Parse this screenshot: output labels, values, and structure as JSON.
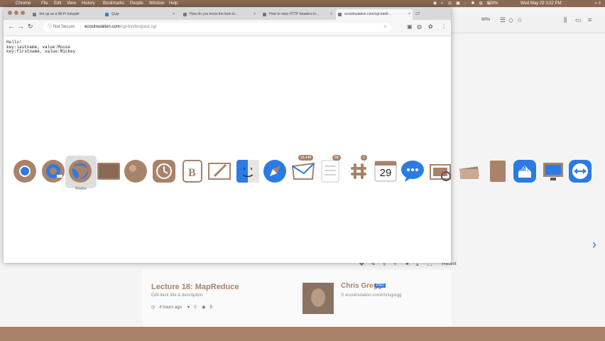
{
  "menubar": {
    "items": [
      "Chrome",
      "File",
      "Edit",
      "View",
      "History",
      "Bookmarks",
      "People",
      "Window",
      "Help"
    ],
    "battery": "100%",
    "clock": "Wed May 29 3:52 PM"
  },
  "chrome": {
    "tabs": [
      {
        "title": "Set up as a Wi-Fi hotspot"
      },
      {
        "title": "Quip"
      },
      {
        "title": "How do you know the item is..."
      },
      {
        "title": "How to view HTTP headers in..."
      },
      {
        "title": "ecosimulation.com/cgi-bin/tr..."
      }
    ],
    "address": {
      "security": "Not Secure",
      "domain": "ecosimulation.com",
      "path": "/cgi-bin/testpost.cgi"
    },
    "content_lines": [
      "Hello!",
      "key:lastname, value:Mouse",
      "key:firstname, value:Mickey"
    ]
  },
  "switcher": {
    "selected_label": "Firefox",
    "apps": [
      {
        "name": "Chrome",
        "icon": "chrome-icon"
      },
      {
        "name": "QuickTime Player",
        "icon": "quicktime-icon"
      },
      {
        "name": "Firefox",
        "icon": "firefox-icon"
      },
      {
        "name": "Terminal",
        "icon": "terminal-icon"
      },
      {
        "name": "Sphere",
        "icon": "sphere-icon"
      },
      {
        "name": "Time Machine",
        "icon": "time-machine-icon"
      },
      {
        "name": "BBEdit",
        "icon": "bbedit-icon"
      },
      {
        "name": "Sketch",
        "icon": "sketch-icon"
      },
      {
        "name": "Finder",
        "icon": "finder-icon"
      },
      {
        "name": "Safari",
        "icon": "safari-icon"
      },
      {
        "name": "Mail",
        "icon": "mail-icon",
        "badge": "16,148"
      },
      {
        "name": "Notes",
        "icon": "notes-icon",
        "badge": "58"
      },
      {
        "name": "Slack",
        "icon": "slack-icon",
        "badge": "1"
      },
      {
        "name": "Calendar",
        "icon": "calendar-icon",
        "text": "29"
      },
      {
        "name": "Messages",
        "icon": "messages-icon"
      },
      {
        "name": "Preview",
        "icon": "preview-icon"
      },
      {
        "name": "Photos Stack",
        "icon": "photos-icon"
      },
      {
        "name": "Notebook",
        "icon": "notebook-icon"
      },
      {
        "name": "Home",
        "icon": "home-icon"
      },
      {
        "name": "Markdown",
        "icon": "markdown-icon",
        "text": "M↓"
      },
      {
        "name": "Screen Sharing",
        "icon": "screen-sharing-icon"
      },
      {
        "name": "TeamViewer",
        "icon": "teamviewer-icon"
      }
    ]
  },
  "background": {
    "zoom": "90%",
    "present_label": "Present",
    "lecture_title": "Lecture 18: MapReduce",
    "lecture_sub": "Edit deck title & description",
    "meta_time": "4 hours ago",
    "meta_likes": "0",
    "meta_views": "6",
    "author_name": "Chris Gregg",
    "author_badge": "PRO",
    "author_link": "ecosimulation.com/chrisgregg"
  },
  "colors": {
    "brand": "#a9826a",
    "accent": "#2c7be5"
  }
}
